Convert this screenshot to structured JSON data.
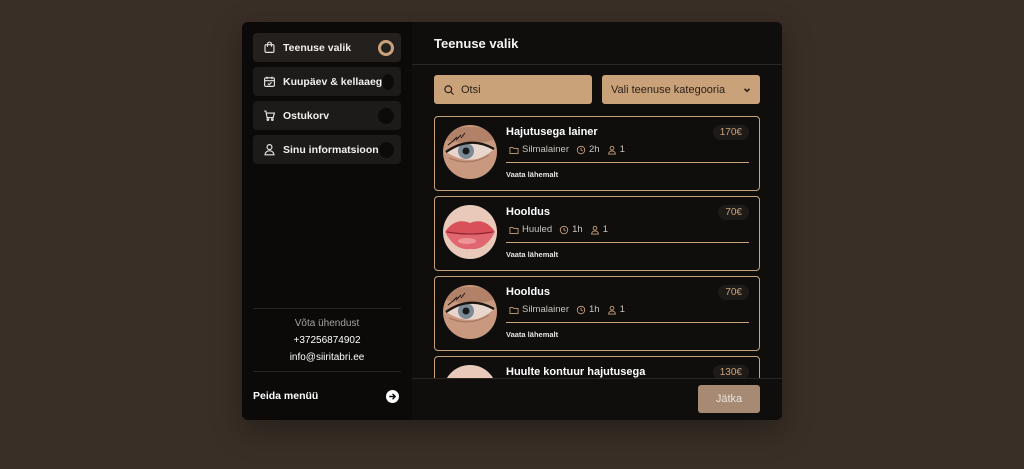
{
  "sidebar": {
    "steps": [
      {
        "label": "Teenuse valik",
        "active": true
      },
      {
        "label": "Kuupäev & kellaaeg",
        "active": false
      },
      {
        "label": "Ostukorv",
        "active": false
      },
      {
        "label": "Sinu informatsioon",
        "active": false
      }
    ],
    "contact": {
      "title": "Võta ühendust",
      "phone": "+37256874902",
      "email": "info@siiritabri.ee"
    },
    "hide_menu_label": "Peida menüü"
  },
  "main": {
    "title": "Teenuse valik",
    "search": {
      "placeholder": "Otsi",
      "value": ""
    },
    "category_select": {
      "label": "Vali teenuse kategooria"
    },
    "services": [
      {
        "title": "Hajutusega lainer",
        "price": "170€",
        "category": "Silmalainer",
        "duration": "2h",
        "persons": "1",
        "link": "Vaata lähemalt",
        "image": "eye"
      },
      {
        "title": "Hooldus",
        "price": "70€",
        "category": "Huuled",
        "duration": "1h",
        "persons": "1",
        "link": "Vaata lähemalt",
        "image": "lips"
      },
      {
        "title": "Hooldus",
        "price": "70€",
        "category": "Silmalainer",
        "duration": "1h",
        "persons": "1",
        "link": "Vaata lähemalt",
        "image": "eye"
      },
      {
        "title": "Huulte kontuur hajutusega",
        "price": "130€",
        "category": "",
        "duration": "",
        "persons": "",
        "link": "",
        "image": "lips"
      }
    ],
    "next_button": "Jätka"
  },
  "colors": {
    "background": "#3a2f27",
    "panel": "#0f0e0d",
    "accent": "#c9a27a",
    "disabled_button": "#a68a73"
  },
  "icons": {
    "steps": [
      "bag-icon",
      "calendar-icon",
      "cart-icon",
      "user-icon"
    ],
    "search": "search-icon",
    "category": "chevron-down-icon",
    "hide_menu": "arrow-right-circle-icon",
    "meta": [
      "folder-icon",
      "clock-icon",
      "person-icon"
    ]
  }
}
